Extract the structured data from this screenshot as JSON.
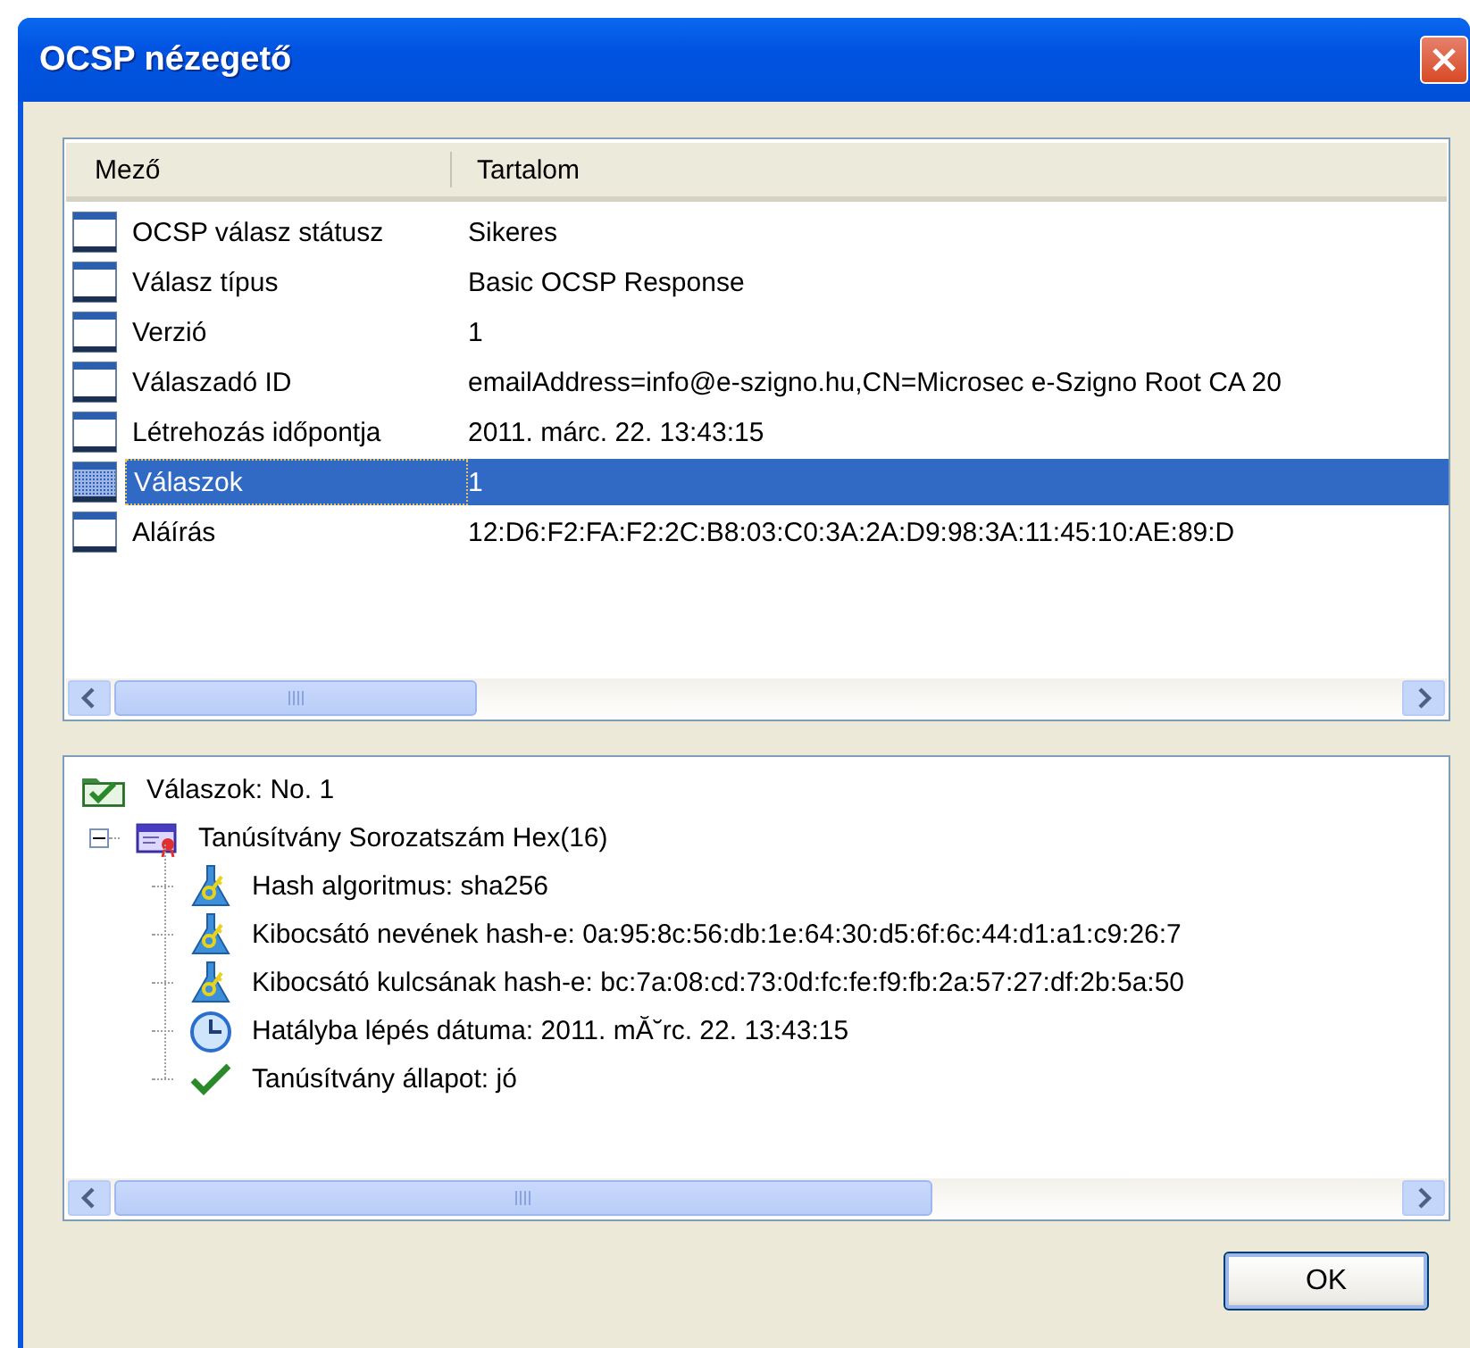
{
  "window": {
    "title": "OCSP nézegető"
  },
  "table": {
    "columns": [
      "Mező",
      "Tartalom"
    ],
    "rows": [
      {
        "field": "OCSP válasz státusz",
        "value": "Sikeres",
        "selected": false
      },
      {
        "field": "Válasz típus",
        "value": "Basic OCSP Response",
        "selected": false
      },
      {
        "field": "Verzió",
        "value": "1",
        "selected": false
      },
      {
        "field": "Válaszadó ID",
        "value": "emailAddress=info@e-szigno.hu,CN=Microsec e-Szigno Root CA 20",
        "selected": false
      },
      {
        "field": "Létrehozás időpontja",
        "value": "2011. márc. 22. 13:43:15",
        "selected": false
      },
      {
        "field": "Válaszok",
        "value": "1",
        "selected": true
      },
      {
        "field": "Aláírás",
        "value": "12:D6:F2:FA:F2:2C:B8:03:C0:3A:2A:D9:98:3A:11:45:10:AE:89:D",
        "selected": false
      }
    ]
  },
  "tree": [
    {
      "kind": "folder-check",
      "label": "Válaszok: No. 1",
      "children": [
        {
          "kind": "certificate",
          "label": "Tanúsítvány Sorozatszám Hex(16)",
          "expanded": true,
          "children": [
            {
              "kind": "hash",
              "label": "Hash algoritmus: sha256"
            },
            {
              "kind": "hash",
              "label": "Kibocsátó nevének hash-e: 0a:95:8c:56:db:1e:64:30:d5:6f:6c:44:d1:a1:c9:26:7"
            },
            {
              "kind": "hash",
              "label": "Kibocsátó kulcsának hash-e: bc:7a:08:cd:73:0d:fc:fe:f9:fb:2a:57:27:df:2b:5a:50"
            },
            {
              "kind": "clock",
              "label": "Hatályba lépés dátuma: 2011. mĂ˘rc. 22. 13:43:15"
            },
            {
              "kind": "check",
              "label": "Tanúsítvány állapot: jó"
            }
          ]
        }
      ]
    }
  ],
  "buttons": [
    "OK"
  ]
}
